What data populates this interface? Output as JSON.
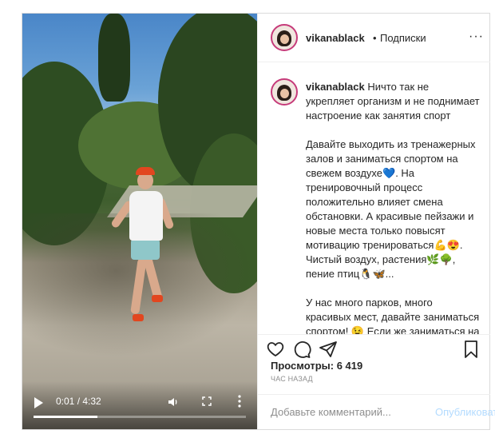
{
  "video": {
    "time": "0:01 / 4:32",
    "progress": 0.3,
    "icons": {
      "play": "play-icon",
      "volume": "volume-icon",
      "fullscreen": "fullscreen-icon",
      "more": "more-vertical-icon"
    }
  },
  "header": {
    "username": "vikanablack",
    "separator": "•",
    "follow_status": "Подписки",
    "more": "···"
  },
  "caption": {
    "username": "vikanablack",
    "p1": "Ничто так не укрепляет организм и не поднимает настроение как занятия спорт",
    "p2": "Давайте выходить из тренажерных залов и заниматься спортом на свежем воздухе💙. На тренировочный процесс положительно влияет смена обстановки. А красивые пейзажи и новые места только повысят мотивацию тренироваться💪😍. Чистый воздух, растения🌿🌳, пение птиц🐧🦋...",
    "p3": "У нас много парков, много красивых мест, давайте заниматься спортом! 😉 Если же заниматься на улице в одиночестве вы стесняетесь, то привлеките к этому полезному делу"
  },
  "actions": {
    "icons": [
      "heart-icon",
      "comment-icon",
      "share-icon",
      "bookmark-icon"
    ]
  },
  "stats": {
    "views": "Просмотры: 6 419",
    "time_ago": "ЧАС НАЗАД"
  },
  "comment": {
    "placeholder": "Добавьте комментарий...",
    "publish": "Опубликовать"
  },
  "colors": {
    "border": "#dbdbdb",
    "text": "#262626",
    "muted": "#8e8e8e",
    "publish_disabled": "#b3dbff",
    "avatar_ring": "#c63b7a"
  }
}
